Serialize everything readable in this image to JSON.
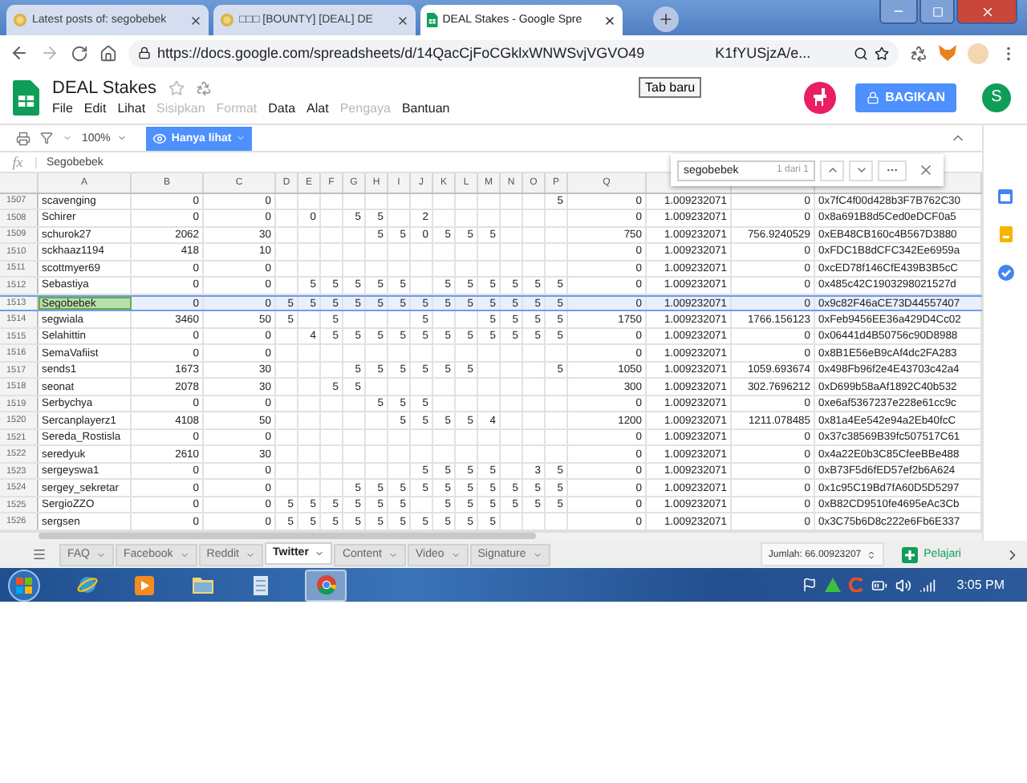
{
  "browser": {
    "tabs": [
      {
        "title": "Latest posts of: segobebek",
        "selected": false,
        "kind": "page"
      },
      {
        "title": "□□□ [BOUNTY] [DEAL] DE",
        "selected": false,
        "kind": "page"
      },
      {
        "title": "DEAL Stakes - Google Spre",
        "selected": true,
        "kind": "document"
      }
    ],
    "tooltip": "Tab baru",
    "url_start": "https://docs.google.com/spreadsheets/d/14QacCjFoCGklxWNWSvjVGVO49",
    "url_end": "K1fYUSjzA/e..."
  },
  "doc": {
    "title": "DEAL Stakes",
    "menu": [
      {
        "label": "File",
        "disabled": false
      },
      {
        "label": "Edit",
        "disabled": false
      },
      {
        "label": "Lihat",
        "disabled": false
      },
      {
        "label": "Sisipkan",
        "disabled": true
      },
      {
        "label": "Format",
        "disabled": true
      },
      {
        "label": "Data",
        "disabled": false
      },
      {
        "label": "Alat",
        "disabled": false
      },
      {
        "label": "Pengaya",
        "disabled": true
      },
      {
        "label": "Bantuan",
        "disabled": false
      }
    ],
    "share_button": "BAGIKAN",
    "avatar": "S"
  },
  "toolbar": {
    "zoom": "100%",
    "mode_button": "Hanya lihat"
  },
  "formula_bar": {
    "fx": "fx",
    "value": "Segobebek"
  },
  "find": {
    "query": "segobebek",
    "count": "1 dari 1"
  },
  "sheet": {
    "columns": [
      "A",
      "B",
      "C",
      "D",
      "E",
      "F",
      "G",
      "H",
      "I",
      "J",
      "K",
      "L",
      "M",
      "N",
      "O",
      "P",
      "Q"
    ],
    "rows": [
      {
        "num": "1507",
        "selected": false,
        "match": false,
        "cells": [
          "scavenging",
          "0",
          "0",
          null,
          null,
          null,
          null,
          null,
          null,
          null,
          null,
          null,
          null,
          null,
          null,
          "5",
          "0",
          "1.009232071",
          "0",
          "0x7fC4f00d428b3F7B762C30"
        ]
      },
      {
        "num": "1508",
        "selected": false,
        "match": false,
        "cells": [
          "Schirer",
          "0",
          "0",
          null,
          "0",
          null,
          "5",
          "5",
          null,
          "2",
          null,
          null,
          null,
          null,
          null,
          null,
          "0",
          "1.009232071",
          "0",
          "0x8a691B8d5Ced0eDCF0a5"
        ]
      },
      {
        "num": "1509",
        "selected": false,
        "match": false,
        "cells": [
          "schurok27",
          "2062",
          "30",
          null,
          null,
          null,
          null,
          "5",
          "5",
          "0",
          "5",
          "5",
          "5",
          null,
          null,
          null,
          "750",
          "1.009232071",
          "756.9240529",
          "0xEB48CB160c4B567D3880"
        ]
      },
      {
        "num": "1510",
        "selected": false,
        "match": false,
        "cells": [
          "sckhaaz1194",
          "418",
          "10",
          null,
          null,
          null,
          null,
          null,
          null,
          null,
          null,
          null,
          null,
          null,
          null,
          null,
          "0",
          "1.009232071",
          "0",
          "0xFDC1B8dCFC342Ee6959a"
        ]
      },
      {
        "num": "1511",
        "selected": false,
        "match": false,
        "cells": [
          "scottmyer69",
          "0",
          "0",
          null,
          null,
          null,
          null,
          null,
          null,
          null,
          null,
          null,
          null,
          null,
          null,
          null,
          "0",
          "1.009232071",
          "0",
          "0xcED78f146CfE439B3B5cC"
        ]
      },
      {
        "num": "1512",
        "selected": false,
        "match": false,
        "cells": [
          "Sebastiya",
          "0",
          "0",
          null,
          "5",
          "5",
          "5",
          "5",
          "5",
          null,
          "5",
          "5",
          "5",
          "5",
          "5",
          "5",
          "0",
          "1.009232071",
          "0",
          "0x485c42C1903298021527d"
        ]
      },
      {
        "num": "1513",
        "selected": true,
        "match": true,
        "cells": [
          "Segobebek",
          "0",
          "0",
          "5",
          "5",
          "5",
          "5",
          "5",
          "5",
          "5",
          "5",
          "5",
          "5",
          "5",
          "5",
          "5",
          "0",
          "1.009232071",
          "0",
          "0x9c82F46aCE73D44557407"
        ]
      },
      {
        "num": "1514",
        "selected": false,
        "match": false,
        "cells": [
          "segwiala",
          "3460",
          "50",
          "5",
          null,
          "5",
          null,
          null,
          null,
          "5",
          null,
          null,
          "5",
          "5",
          "5",
          "5",
          "1750",
          "1.009232071",
          "1766.156123",
          "0xFeb9456EE36a429D4Cc02"
        ]
      },
      {
        "num": "1515",
        "selected": false,
        "match": false,
        "cells": [
          "Selahittin",
          "0",
          "0",
          null,
          "4",
          "5",
          "5",
          "5",
          "5",
          "5",
          "5",
          "5",
          "5",
          "5",
          "5",
          "5",
          "0",
          "1.009232071",
          "0",
          "0x06441d4B50756c90D8988"
        ]
      },
      {
        "num": "1516",
        "selected": false,
        "match": false,
        "cells": [
          "SemaVafiist",
          "0",
          "0",
          null,
          null,
          null,
          null,
          null,
          null,
          null,
          null,
          null,
          null,
          null,
          null,
          null,
          "0",
          "1.009232071",
          "0",
          "0x8B1E56eB9cAf4dc2FA283"
        ]
      },
      {
        "num": "1517",
        "selected": false,
        "match": false,
        "cells": [
          "sends1",
          "1673",
          "30",
          null,
          null,
          null,
          "5",
          "5",
          "5",
          "5",
          "5",
          "5",
          null,
          null,
          null,
          "5",
          "1050",
          "1.009232071",
          "1059.693674",
          "0x498Fb96f2e4E43703c42a4"
        ]
      },
      {
        "num": "1518",
        "selected": false,
        "match": false,
        "cells": [
          "seonat",
          "2078",
          "30",
          null,
          null,
          "5",
          "5",
          null,
          null,
          null,
          null,
          null,
          null,
          null,
          null,
          null,
          "300",
          "1.009232071",
          "302.7696212",
          "0xD699b58aAf1892C40b532"
        ]
      },
      {
        "num": "1519",
        "selected": false,
        "match": false,
        "cells": [
          "Serbychya",
          "0",
          "0",
          null,
          null,
          null,
          null,
          "5",
          "5",
          "5",
          null,
          null,
          null,
          null,
          null,
          null,
          "0",
          "1.009232071",
          "0",
          "0xe6af5367237e228e61cc9c"
        ]
      },
      {
        "num": "1520",
        "selected": false,
        "match": false,
        "cells": [
          "Sercanplayerz1",
          "4108",
          "50",
          null,
          null,
          null,
          null,
          null,
          "5",
          "5",
          "5",
          "5",
          "4",
          null,
          null,
          null,
          "1200",
          "1.009232071",
          "1211.078485",
          "0x81a4Ee542e94a2Eb40fcC"
        ]
      },
      {
        "num": "1521",
        "selected": false,
        "match": false,
        "cells": [
          "Sereda_Rostisla",
          "0",
          "0",
          null,
          null,
          null,
          null,
          null,
          null,
          null,
          null,
          null,
          null,
          null,
          null,
          null,
          "0",
          "1.009232071",
          "0",
          "0x37c38569B39fc507517C61"
        ]
      },
      {
        "num": "1522",
        "selected": false,
        "match": false,
        "cells": [
          "seredyuk",
          "2610",
          "30",
          null,
          null,
          null,
          null,
          null,
          null,
          null,
          null,
          null,
          null,
          null,
          null,
          null,
          "0",
          "1.009232071",
          "0",
          "0x4a22E0b3C85CfeeBBe488"
        ]
      },
      {
        "num": "1523",
        "selected": false,
        "match": false,
        "cells": [
          "sergeyswa1",
          "0",
          "0",
          null,
          null,
          null,
          null,
          null,
          null,
          "5",
          "5",
          "5",
          "5",
          null,
          "3",
          "5",
          "0",
          "1.009232071",
          "0",
          "0xB73F5d6fED57ef2b6A624"
        ]
      },
      {
        "num": "1524",
        "selected": false,
        "match": false,
        "cells": [
          "sergey_sekretar",
          "0",
          "0",
          null,
          null,
          null,
          "5",
          "5",
          "5",
          "5",
          "5",
          "5",
          "5",
          "5",
          "5",
          "5",
          "0",
          "1.009232071",
          "0",
          "0x1c95C19Bd7fA60D5D5297"
        ]
      },
      {
        "num": "1525",
        "selected": false,
        "match": false,
        "cells": [
          "SergioZZO",
          "0",
          "0",
          "5",
          "5",
          "5",
          "5",
          "5",
          "5",
          null,
          "5",
          "5",
          "5",
          "5",
          "5",
          "5",
          "0",
          "1.009232071",
          "0",
          "0xB82CD9510fe4695eAc3Cb"
        ]
      },
      {
        "num": "1526",
        "selected": false,
        "match": false,
        "cells": [
          "sergsen",
          "0",
          "0",
          "5",
          "5",
          "5",
          "5",
          "5",
          "5",
          "5",
          "5",
          "5",
          "5",
          null,
          null,
          null,
          "0",
          "1.009232071",
          "0",
          "0x3C75b6D8c222e6Fb6E337"
        ]
      }
    ]
  },
  "sheet_tabs": [
    {
      "label": "FAQ",
      "selected": false
    },
    {
      "label": "Facebook",
      "selected": false
    },
    {
      "label": "Reddit",
      "selected": false
    },
    {
      "label": "Twitter",
      "selected": true
    },
    {
      "label": "Content",
      "selected": false
    },
    {
      "label": "Video",
      "selected": false
    },
    {
      "label": "Signature",
      "selected": false
    }
  ],
  "sum": "Jumlah: 66.00923207",
  "explore": "Pelajari",
  "taskbar": {
    "clock": "3:05 PM"
  }
}
